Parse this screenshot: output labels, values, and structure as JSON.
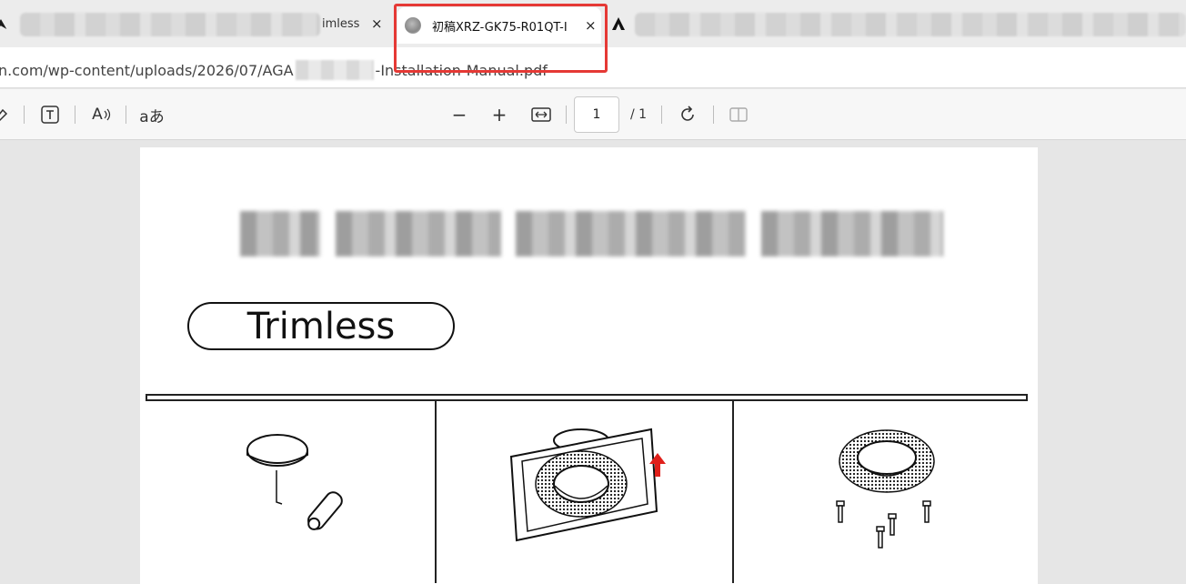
{
  "tabs": {
    "left": {
      "title": "imless",
      "close_icon": "×"
    },
    "active": {
      "title": "初稿XRZ-GK75-R01QT-I",
      "close_icon": "×"
    },
    "right_logo": "A"
  },
  "address": {
    "url_prefix": "n.com/wp-content/uploads/2026/07/AGA",
    "url_suffix": "-Installation-Manual.pdf"
  },
  "toolbar": {
    "draw_icon": "draw-icon",
    "text_icon": "T",
    "read_aloud_label": "A",
    "translate_label": "aあ",
    "zoom_out": "−",
    "zoom_in": "+",
    "fit_icon": "⇔",
    "page_number": "1",
    "page_count": "/ 1",
    "rotate_icon": "rotate-icon",
    "two_page_icon": "two-page-icon"
  },
  "document": {
    "badge_text": "Trimless"
  },
  "colors": {
    "highlight": "#e53935",
    "arrow": "#e0201b"
  }
}
